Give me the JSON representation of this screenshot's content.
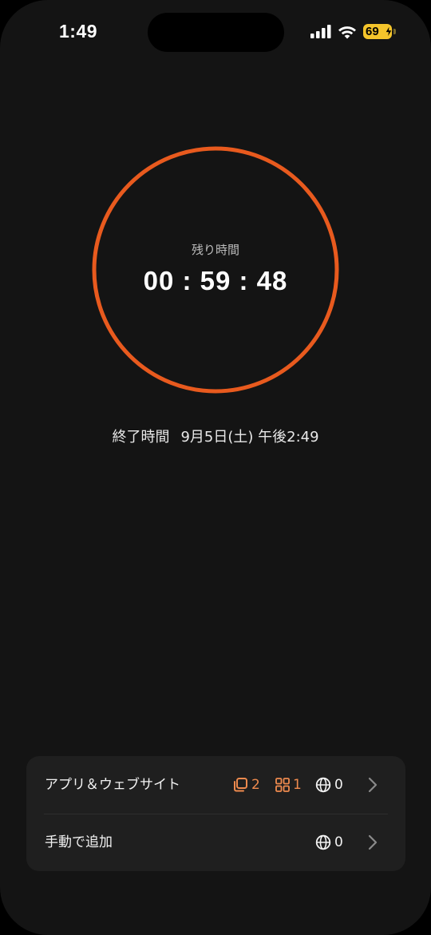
{
  "status_bar": {
    "time": "1:49",
    "battery": "69",
    "icons": [
      "cellular-signal-icon",
      "wifi-icon",
      "battery-charging-icon"
    ]
  },
  "timer": {
    "label": "残り時間",
    "remaining": "00 : 59 : 48",
    "ring_color": "#e85a1e"
  },
  "end_time": {
    "label": "終了時間",
    "value": "9月5日(土) 午後2:49"
  },
  "card": {
    "rows": [
      {
        "label": "アプリ＆ウェブサイト",
        "apps_count": "2",
        "categories_count": "1",
        "web_count": "0"
      },
      {
        "label": "手動で追加",
        "web_count": "0"
      }
    ]
  },
  "colors": {
    "background": "#141414",
    "card": "#1f1f1f",
    "accent": "#ee8a4e",
    "battery": "#f5c52b"
  }
}
